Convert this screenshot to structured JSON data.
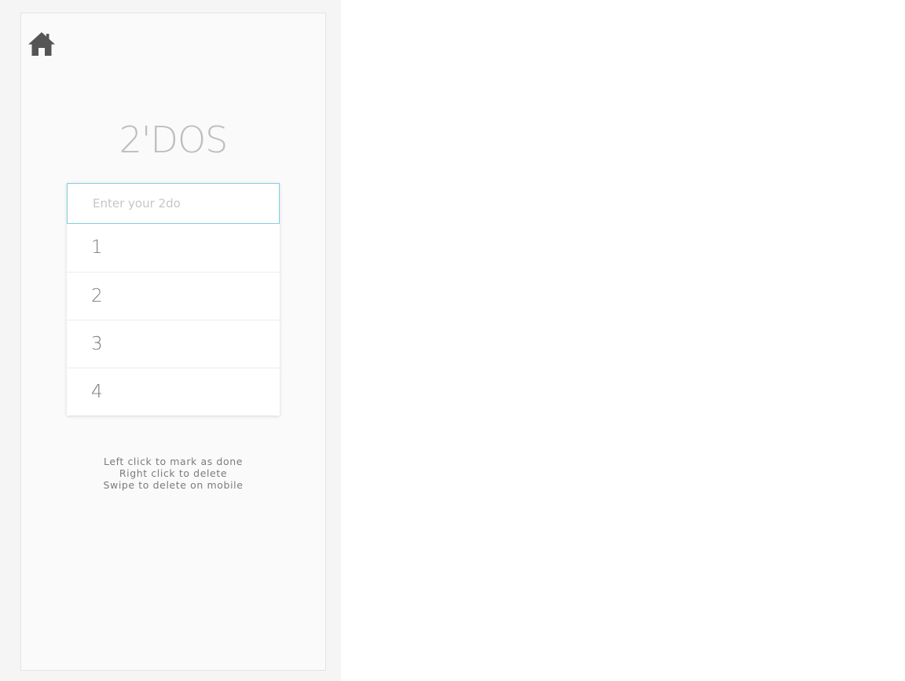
{
  "app": {
    "title": "2'DOS",
    "home_icon": "home-icon",
    "colors": {
      "input_border": "#7fd0df",
      "title": "#bdbdbd",
      "icon": "#555555"
    }
  },
  "input": {
    "placeholder": "Enter your 2do",
    "value": ""
  },
  "todos": [
    {
      "text": "1"
    },
    {
      "text": "2"
    },
    {
      "text": "3"
    },
    {
      "text": "4"
    }
  ],
  "hints": [
    "Left click to mark as done",
    "Right click to delete",
    "Swipe to delete on mobile"
  ]
}
